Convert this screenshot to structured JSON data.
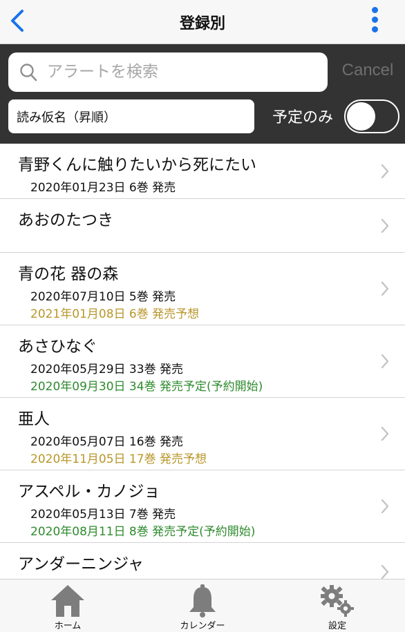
{
  "header": {
    "title": "登録別"
  },
  "search": {
    "placeholder": "アラートを検索",
    "value": "",
    "cancel_label": "Cancel"
  },
  "filters": {
    "sort_value": "読み仮名（昇順）",
    "scheduled_only_label": "予定のみ",
    "scheduled_only_on": false
  },
  "list": {
    "items": [
      {
        "title": "青野くんに触りたいから死にたい",
        "line1": "2020年01月23日 6巻 発売",
        "line2": "",
        "line2_status": ""
      },
      {
        "title": "あおのたつき",
        "line1": "",
        "line2": "",
        "line2_status": ""
      },
      {
        "title": "青の花 器の森",
        "line1": "2020年07月10日 5巻 発売",
        "line2": "2021年01月08日 6巻 発売予想",
        "line2_status": "forecast"
      },
      {
        "title": "あさひなぐ",
        "line1": "2020年05月29日 33巻 発売",
        "line2": "2020年09月30日 34巻 発売予定(予約開始)",
        "line2_status": "scheduled"
      },
      {
        "title": "亜人",
        "line1": "2020年05月07日 16巻 発売",
        "line2": "2020年11月05日 17巻 発売予想",
        "line2_status": "forecast"
      },
      {
        "title": "アスペル・カノジョ",
        "line1": "2020年05月13日 7巻 発売",
        "line2": "2020年08月11日 8巻 発売予定(予約開始)",
        "line2_status": "scheduled"
      },
      {
        "title": "アンダーニンジャ",
        "line1": "",
        "line2": "",
        "line2_status": ""
      }
    ]
  },
  "tabbar": {
    "tabs": [
      {
        "label": "ホーム",
        "icon": "home-icon"
      },
      {
        "label": "カレンダー",
        "icon": "bell-icon"
      },
      {
        "label": "設定",
        "icon": "gear-icon"
      }
    ]
  },
  "colors": {
    "accent": "#1a73e8",
    "forecast": "#b8962a",
    "scheduled": "#2e8b2e",
    "search_bar_bg": "#333333"
  }
}
